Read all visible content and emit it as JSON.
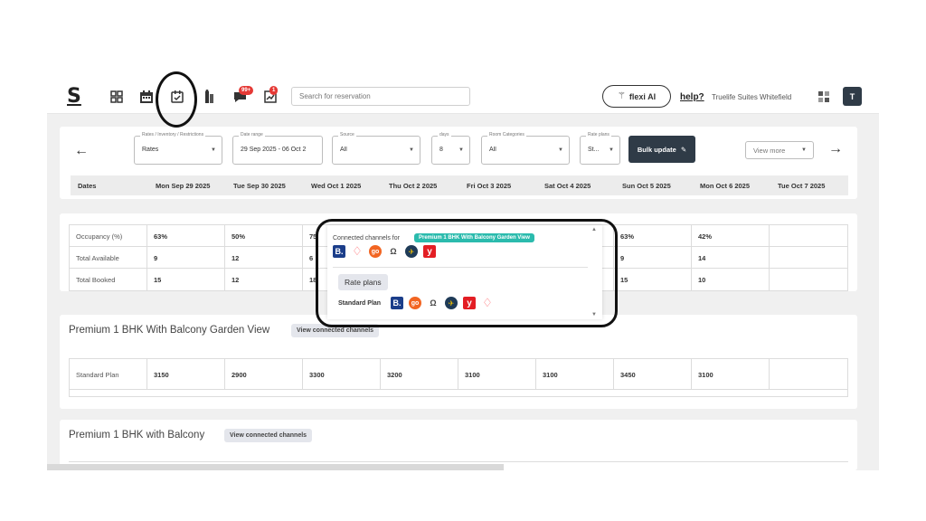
{
  "topnav": {
    "logo": "S",
    "search_placeholder": "Search for reservation",
    "messages_badge": "99+",
    "alerts_badge": "1",
    "flexi_label": "flexi AI",
    "help_label": "help?",
    "property_name": "Truelife Suites Whitefield",
    "avatar_initial": "T",
    "icons": [
      "dashboard-icon",
      "calendar-icon",
      "rates-calendar-icon",
      "housekeeping-icon",
      "messages-icon",
      "reports-icon",
      "apps-grid-icon"
    ]
  },
  "filters": {
    "rates_label": "Rates / Inventory / Restrictions",
    "rates_value": "Rates",
    "date_label": "Date range",
    "date_value": "29 Sep 2025 - 06 Oct 2",
    "source_label": "Source",
    "source_value": "All",
    "days_label": "days",
    "days_value": "8",
    "room_label": "Room Categories",
    "room_value": "All",
    "rateplan_label": "Rate plans",
    "rateplan_value": "St...",
    "bulk_label": "Bulk update",
    "viewmore_label": "View more"
  },
  "dates_header": [
    "Dates",
    "Mon Sep 29 2025",
    "Tue Sep 30 2025",
    "Wed Oct 1 2025",
    "Thu Oct 2 2025",
    "Fri Oct 3 2025",
    "Sat Oct 4 2025",
    "Sun Oct 5 2025",
    "Mon Oct 6 2025",
    "Tue Oct 7 2025"
  ],
  "stats": [
    {
      "label": "Occupancy (%)",
      "values": [
        "63%",
        "50%",
        "75",
        "",
        "",
        "",
        "63%",
        "42%",
        ""
      ]
    },
    {
      "label": "Total Available",
      "values": [
        "9",
        "12",
        "6",
        "",
        "",
        "",
        "9",
        "14",
        ""
      ]
    },
    {
      "label": "Total Booked",
      "values": [
        "15",
        "12",
        "18",
        "",
        "",
        "",
        "15",
        "10",
        ""
      ]
    }
  ],
  "rooms": [
    {
      "title": "Premium 1 BHK With Balcony Garden View",
      "channels_button": "View connected channels",
      "plan": "Standard Plan",
      "rates": [
        "3150",
        "2900",
        "3300",
        "3200",
        "3100",
        "3100",
        "3450",
        "3100",
        ""
      ]
    },
    {
      "title": "Premium 1 BHK with Balcony",
      "channels_button": "View connected channels"
    }
  ],
  "popup": {
    "label": "Connected channels for",
    "room_name": "Premium 1 BHK With Balcony Garden View",
    "channels": [
      "booking-com-icon",
      "airbnb-icon",
      "goibibo-icon",
      "agoda-icon",
      "expedia-icon",
      "yatra-icon"
    ],
    "rate_plans_label": "Rate plans",
    "plan_name": "Standard Plan",
    "plan_channels": [
      "booking-com-icon",
      "goibibo-icon",
      "agoda-icon",
      "expedia-icon",
      "yatra-icon",
      "airbnb-icon"
    ]
  },
  "colors": {
    "primary_dark": "#2f3b47",
    "badge_red": "#e53935",
    "teal_tag": "#2bbbad",
    "booking_blue": "#1b3e8a",
    "airbnb": "#ff5a5f",
    "goibibo": "#f26522",
    "yatra": "#e31e24"
  }
}
